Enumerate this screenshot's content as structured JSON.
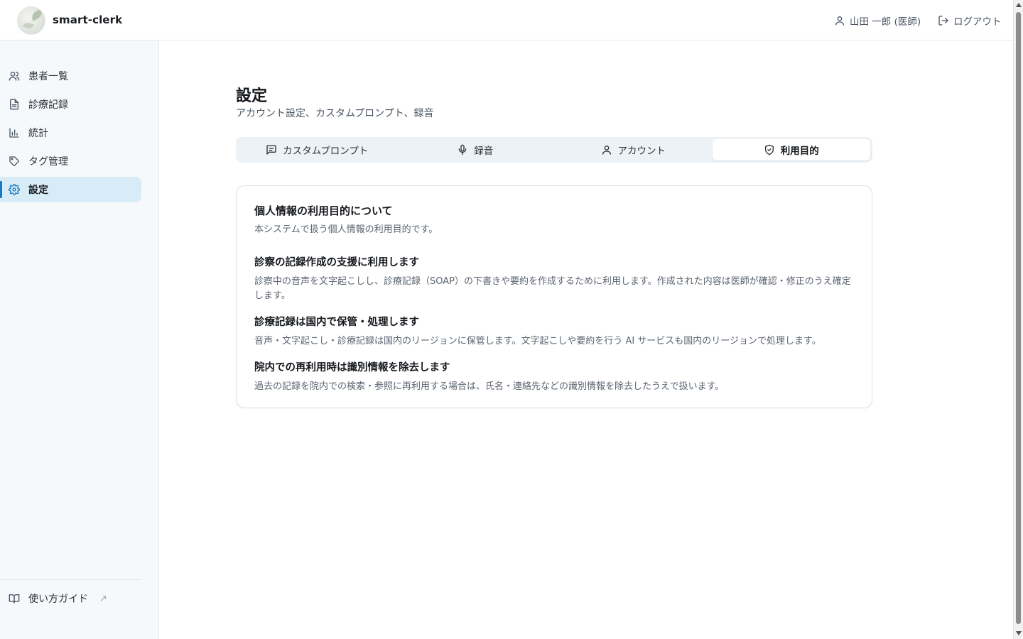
{
  "app": {
    "name": "smart-clerk"
  },
  "header": {
    "user_label": "山田 一郎 (医師)",
    "logout_label": "ログアウト"
  },
  "sidebar": {
    "items": [
      {
        "label": "患者一覧",
        "icon": "users-icon"
      },
      {
        "label": "診療記録",
        "icon": "document-icon"
      },
      {
        "label": "統計",
        "icon": "bar-chart-icon"
      },
      {
        "label": "タグ管理",
        "icon": "tag-icon"
      },
      {
        "label": "設定",
        "icon": "gear-icon",
        "active": true
      }
    ],
    "guide_label": "使い方ガイド",
    "guide_ext": "↗"
  },
  "page": {
    "title": "設定",
    "subtitle": "アカウント設定、カスタムプロンプト、録音"
  },
  "tabs": [
    {
      "label": "カスタムプロンプト",
      "icon": "message-square-icon"
    },
    {
      "label": "録音",
      "icon": "microphone-icon"
    },
    {
      "label": "アカウント",
      "icon": "user-icon"
    },
    {
      "label": "利用目的",
      "icon": "shield-check-icon",
      "active": true
    }
  ],
  "card": {
    "title": "個人情報の利用目的について",
    "description": "本システムで扱う個人情報の利用目的です。",
    "sections": [
      {
        "heading": "診察の記録作成の支援に利用します",
        "body": "診察中の音声を文字起こしし、診療記録（SOAP）の下書きや要約を作成するために利用します。作成された内容は医師が確認・修正のうえ確定します。"
      },
      {
        "heading": "診療記録は国内で保管・処理します",
        "body": "音声・文字起こし・診療記録は国内のリージョンに保管します。文字起こしや要約を行う AI サービスも国内のリージョンで処理します。"
      },
      {
        "heading": "院内での再利用時は識別情報を除去します",
        "body": "過去の記録を院内での検索・参照に再利用する場合は、氏名・連絡先などの識別情報を除去したうえで扱います。"
      }
    ]
  },
  "colors": {
    "accent": "#1979c2",
    "active_bg": "#d8ecf7",
    "sidebar_bg": "#f6f9fb"
  }
}
